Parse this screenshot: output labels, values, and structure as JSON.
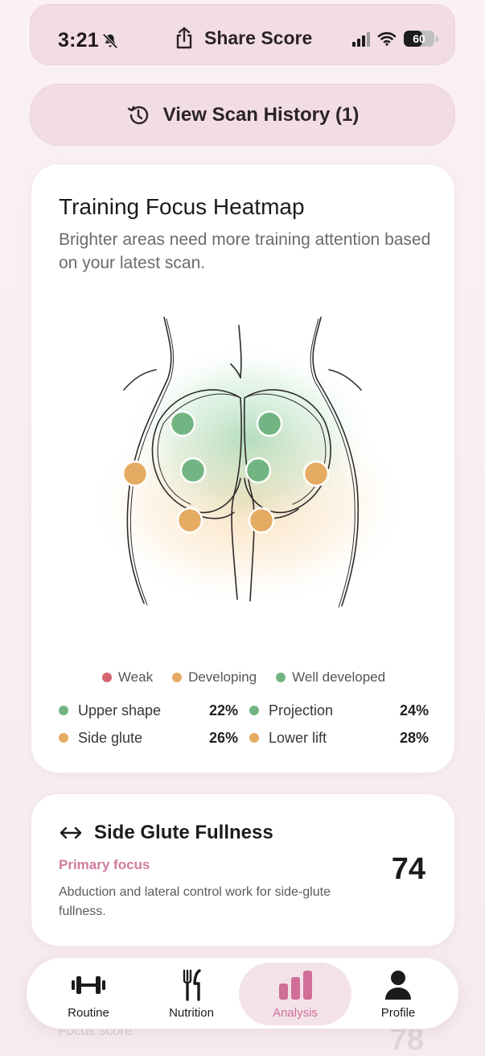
{
  "status_bar": {
    "time": "3:21",
    "share_label": "Share Score",
    "battery": "60",
    "battery_level": 0.6
  },
  "history_button": {
    "label": "View Scan History (1)"
  },
  "heatmap": {
    "title": "Training Focus Heatmap",
    "subtitle": "Brighter areas need more training attention based on your latest scan.",
    "legend": [
      {
        "label": "Weak",
        "color": "#d4656f"
      },
      {
        "label": "Developing",
        "color": "#e6ab62"
      },
      {
        "label": "Well developed",
        "color": "#72b582"
      }
    ],
    "stats": [
      {
        "name": "Upper shape",
        "value": "22%",
        "color": "#72b582"
      },
      {
        "name": "Projection",
        "value": "24%",
        "color": "#72b582"
      },
      {
        "name": "Side glute",
        "value": "26%",
        "color": "#e6ab62"
      },
      {
        "name": "Lower lift",
        "value": "28%",
        "color": "#e6ab62"
      }
    ]
  },
  "focus_card": {
    "title": "Side Glute Fullness",
    "tag": "Primary focus",
    "description": "Abduction and lateral control work for side-glute fullness.",
    "score": "74",
    "icon": "arrows-horizontal-icon"
  },
  "next_card_peek": {
    "label": "Focus score",
    "score": "78"
  },
  "nav": {
    "items": [
      {
        "label": "Routine",
        "icon": "dumbbell-icon"
      },
      {
        "label": "Nutrition",
        "icon": "fork-knife-icon"
      },
      {
        "label": "Analysis",
        "icon": "bar-chart-icon",
        "active": true
      },
      {
        "label": "Profile",
        "icon": "person-icon"
      }
    ]
  },
  "colors": {
    "accent": "#d06e97",
    "well_developed": "#72b582",
    "developing": "#e6ab62",
    "weak": "#d4656f"
  }
}
